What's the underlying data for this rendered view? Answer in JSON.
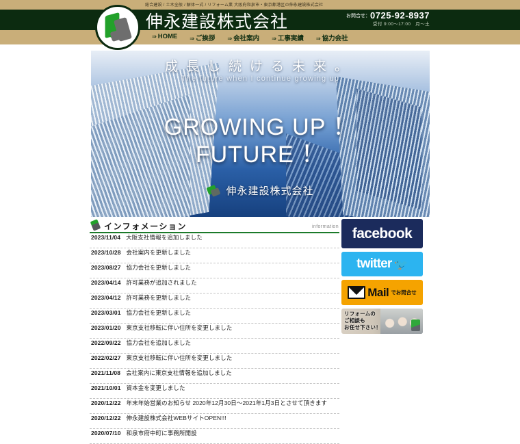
{
  "header": {
    "tagline": "総合建設 / 土木全般 / 解体一式 / リフォーム業 大阪府和泉市・東京都港区の伸永建設株式会社",
    "company_name": "伸永建設株式会社",
    "contact_label": "お問合せ",
    "contact_separator": "：",
    "phone": "0725-92-8937",
    "hours": "受付 9:00～17:00　月～土",
    "logo_icon": "company-logo-icon",
    "nav": [
      {
        "arrow": "⇒",
        "label": "HOME"
      },
      {
        "arrow": "⇒",
        "label": "ご挨拶"
      },
      {
        "arrow": "⇒",
        "label": "会社案内"
      },
      {
        "arrow": "⇒",
        "label": "工事実績"
      },
      {
        "arrow": "⇒",
        "label": "協力会社"
      }
    ]
  },
  "hero": {
    "headline": "成長し続ける未来。",
    "subtitle": "The future when I continue growing up",
    "big_line1": "GROWING UP ！",
    "big_line2": "FUTURE ！",
    "logo_text": "伸永建設株式会社"
  },
  "info": {
    "title": "インフォメーション",
    "title_en": "information",
    "news": [
      {
        "date": "2023/11/04",
        "text": "大阪支社情報を追加しました"
      },
      {
        "date": "2023/10/28",
        "text": "会社案内を更新しました"
      },
      {
        "date": "2023/08/27",
        "text": "協力会社を更新しました"
      },
      {
        "date": "2023/04/14",
        "text": "許可業務が追加されました"
      },
      {
        "date": "2023/04/12",
        "text": "許可業務を更新しました"
      },
      {
        "date": "2023/03/01",
        "text": "協力会社を更新しました"
      },
      {
        "date": "2023/01/20",
        "text": "東京支社移転に伴い住所を変更しました"
      },
      {
        "date": "2022/09/22",
        "text": "協力会社を追加しました"
      },
      {
        "date": "2022/02/27",
        "text": "東京支社移転に伴い住所を変更しました"
      },
      {
        "date": "2021/11/08",
        "text": "会社案内に東京支社情報を追加しました"
      },
      {
        "date": "2021/10/01",
        "text": "資本金を変更しました"
      },
      {
        "date": "2020/12/22",
        "text": "年末年始営業のお知らせ 2020年12月30日～2021年1月3日とさせて頂きます"
      },
      {
        "date": "2020/12/22",
        "text": "伸永建設株式会社WEBサイトOPEN!!!"
      },
      {
        "date": "2020/07/10",
        "text": "和泉市府中町に事務所開設"
      }
    ]
  },
  "sidebar": {
    "facebook": {
      "label": "facebook",
      "color": "#1b2b5c"
    },
    "twitter": {
      "label": "twitter",
      "bird_icon": "twitter-bird-icon",
      "color": "#2cb4f0"
    },
    "mail": {
      "icon": "envelope-icon",
      "label": "Mail",
      "sub_label": "でお問合せ",
      "color": "#f5a300"
    },
    "reform": {
      "line1": "リフォームの",
      "line2": "ご相談も",
      "line3": "お任せ下さい！"
    }
  }
}
